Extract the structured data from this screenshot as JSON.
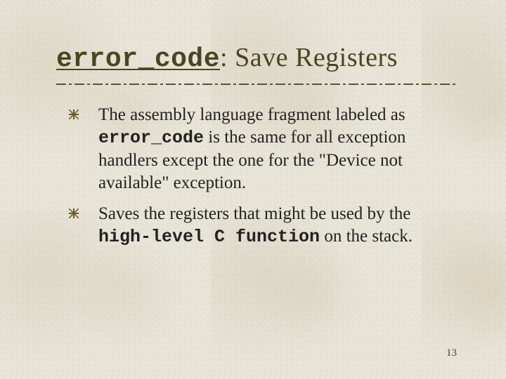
{
  "title": {
    "code": "error_code",
    "rest": ": Save Registers"
  },
  "bullets": [
    {
      "pre": "The assembly language fragment labeled as ",
      "code": "error_code",
      "post": " is the same for all exception handlers except the one for the \"Device not available\" exception."
    },
    {
      "pre": "Saves the registers that might be used by the ",
      "code": "high-level C function",
      "post": " on the stack."
    }
  ],
  "page_number": "13"
}
